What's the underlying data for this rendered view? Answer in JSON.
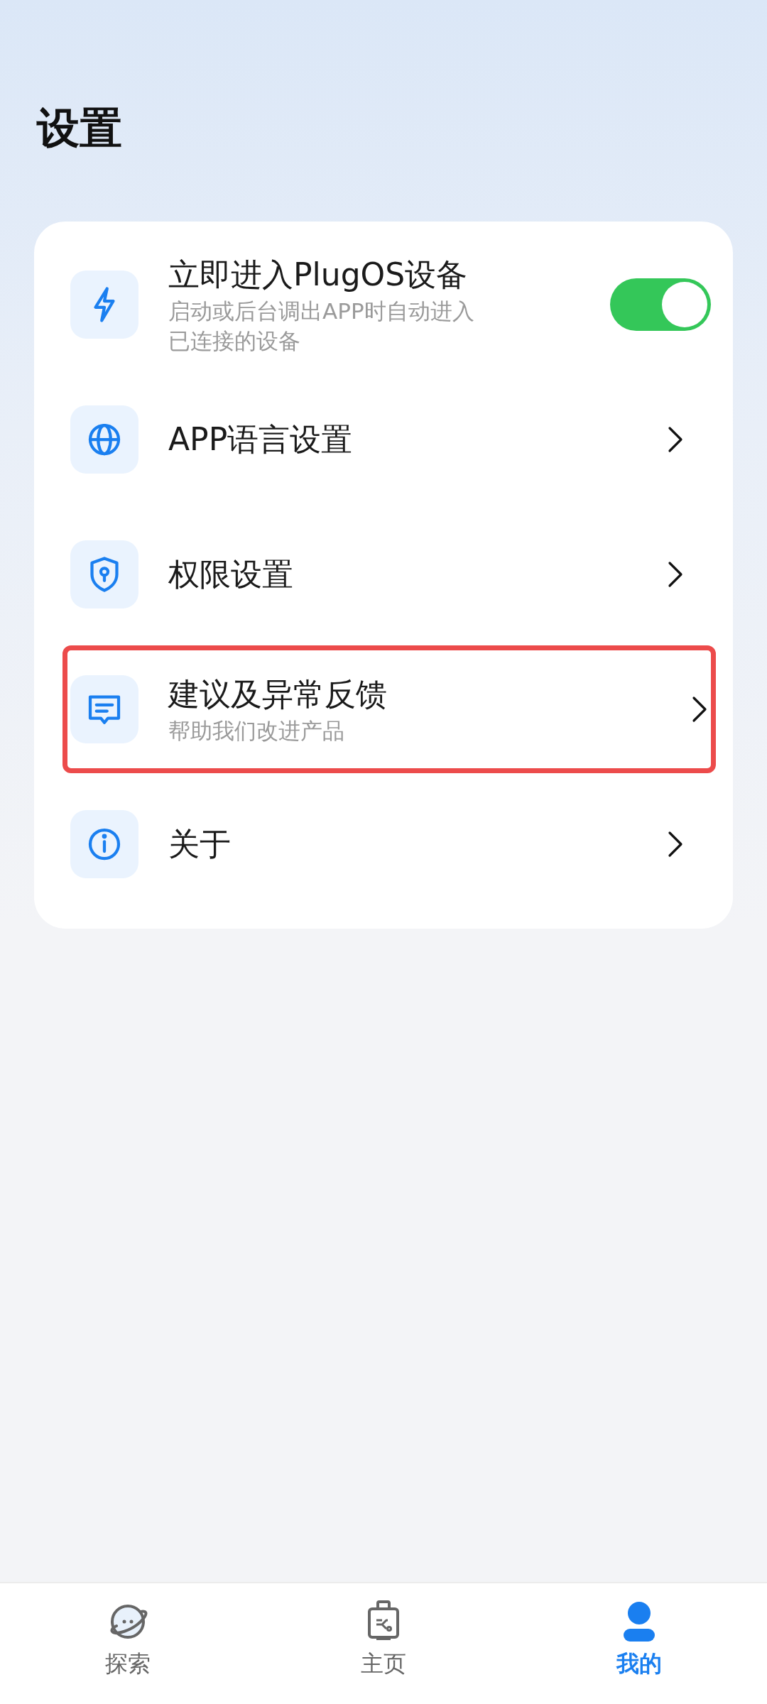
{
  "title": "设置",
  "settings": [
    {
      "kind": "toggle",
      "label": "立即进入PlugOS设备",
      "subtitle_lines": [
        "启动或后台调出APP时自动进入",
        "已连接的设备"
      ],
      "on": true,
      "highlighted": false
    },
    {
      "kind": "link",
      "label": "APP语言设置",
      "highlighted": false
    },
    {
      "kind": "link",
      "label": "权限设置",
      "highlighted": false
    },
    {
      "kind": "link",
      "label": "建议及异常反馈",
      "subtitle_lines": [
        "帮助我们改进产品"
      ],
      "highlighted": true
    },
    {
      "kind": "link",
      "label": "关于",
      "highlighted": false
    }
  ],
  "tab_bar": [
    {
      "label": "探索",
      "selected": false
    },
    {
      "label": "主页",
      "selected": false
    },
    {
      "label": "我的",
      "selected": true
    }
  ]
}
